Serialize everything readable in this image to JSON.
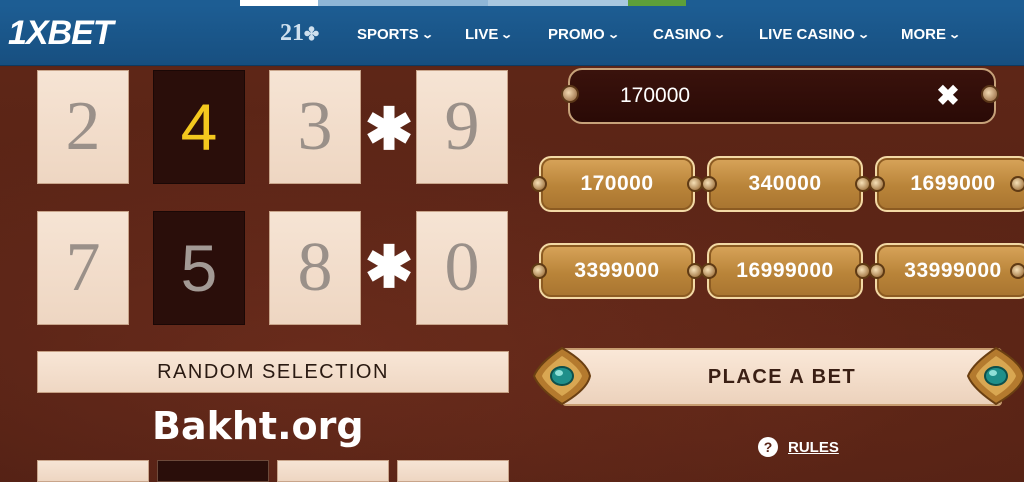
{
  "header": {
    "logo_prefix": "1X",
    "logo_suffix": "BET",
    "brand_mark": "21",
    "nav": [
      {
        "label": "SPORTS"
      },
      {
        "label": "LIVE"
      },
      {
        "label": "PROMO"
      },
      {
        "label": "CASINO"
      },
      {
        "label": "LIVE CASINO"
      },
      {
        "label": "MORE"
      }
    ]
  },
  "colors": {
    "nav_bg": "#1d5d93",
    "game_bg": "#5a2518",
    "selected_digit": "#f3c81e",
    "chip_gold": "#c08a3e"
  },
  "board": {
    "row1": {
      "d1": "2",
      "d2": "4",
      "d3": "3",
      "separator": "✱",
      "d4": "9"
    },
    "row2": {
      "d1": "7",
      "d2": "5",
      "d3": "8",
      "separator": "✱",
      "d4": "0"
    }
  },
  "random_selection_label": "RANDOM SELECTION",
  "watermark": "Bakht.org",
  "bet": {
    "amount": "170000",
    "clear_glyph": "✖",
    "chips": [
      "170000",
      "340000",
      "1699000",
      "3399000",
      "16999000",
      "33999000"
    ],
    "place_label": "PLACE A BET"
  },
  "rules": {
    "icon": "?",
    "label": "RULES"
  }
}
